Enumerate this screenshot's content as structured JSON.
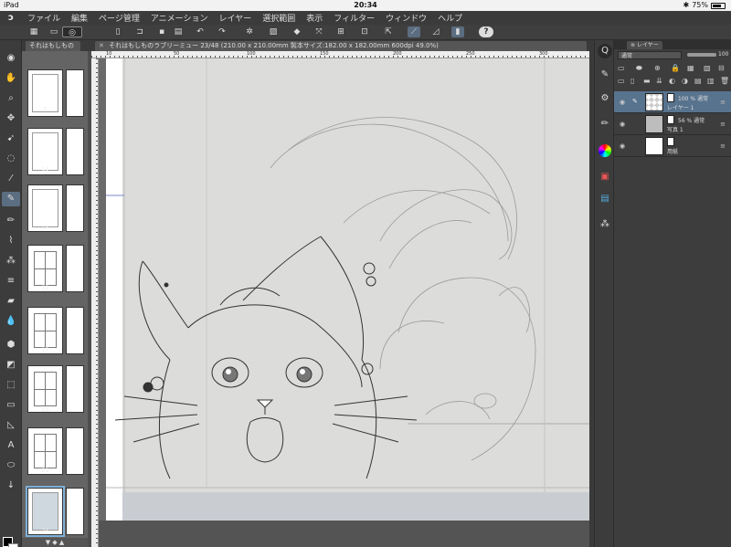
{
  "status_bar": {
    "device": "iPad",
    "time": "20:34",
    "battery": "75%",
    "battery_level": 0.75
  },
  "menu": {
    "items": [
      "ファイル",
      "編集",
      "ページ管理",
      "アニメーション",
      "レイヤー",
      "選択範囲",
      "表示",
      "フィルター",
      "ウィンドウ",
      "ヘルプ"
    ]
  },
  "tabs": {
    "pages_tab": "それはもしもの",
    "doc_tab": "それはもしものラブリーミュー 23/48 (210.00 x 210.00mm 製本サイズ:182.00 x 182.00mm 600dpi 49.0%)"
  },
  "pages": {
    "numbers": [
      "9",
      "11",
      "13",
      "15",
      "17",
      "19",
      "21",
      "23"
    ],
    "selected": "23"
  },
  "rulers": {
    "top_labels": [
      "10",
      "50",
      "100",
      "150",
      "200",
      "250",
      "300"
    ]
  },
  "layer_panel": {
    "tab_label": "レイヤー",
    "blend_mode": "通常",
    "opacity": "100",
    "layers": [
      {
        "line1": "100 % 通常",
        "line2": "レイヤー 1",
        "selected": true,
        "thumb": "checker"
      },
      {
        "line1": "56 % 通常",
        "line2": "写真 1",
        "selected": false,
        "thumb": "photo"
      },
      {
        "line1": "",
        "line2": "用紙",
        "selected": false,
        "thumb": "white"
      }
    ]
  },
  "colors": {
    "accent": "#58738e",
    "selected_tool": "#5b6d80",
    "foreground": "#000000",
    "background": "#ffffff"
  }
}
